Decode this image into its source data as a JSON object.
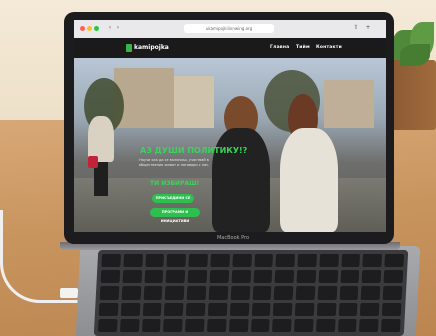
{
  "browser": {
    "url": "ukamipojkliinnwing.org"
  },
  "site": {
    "logo": "kamipojka",
    "nav": [
      "Главна",
      "Тийм",
      "Контакти"
    ],
    "headline": "АЗ ДУШИ ПОЛИТИКУ!?",
    "subtext": "Научи как да се включиш, участвай в обществения живот и поговори с нас.",
    "headline2": "ТИ ИЗБИРАШ!",
    "cta_primary": "ПРИСЪЕДИНИ СЕ",
    "cta_secondary": "ПРОГРАМИ И ИНИЦИАТИВИ"
  },
  "device": {
    "bezel_label": "MacBook Pro"
  },
  "colors": {
    "accent_green": "#3ad45a",
    "button_green": "#2fbf4f"
  }
}
